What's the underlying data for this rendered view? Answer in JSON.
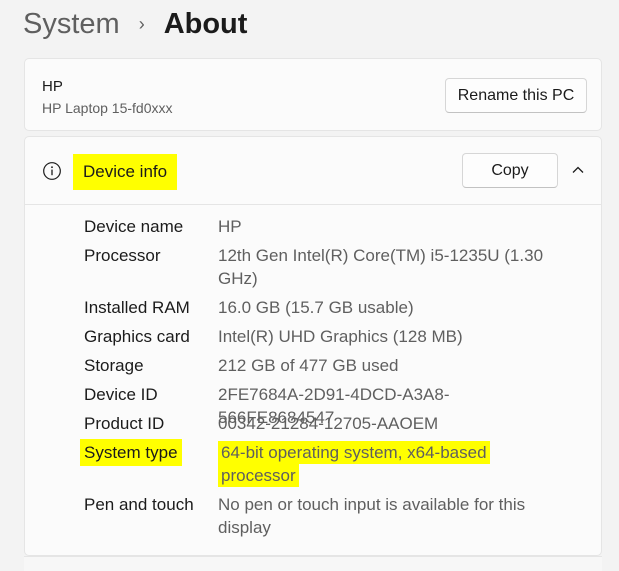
{
  "breadcrumb": {
    "parent": "System",
    "separator": "›",
    "current": "About"
  },
  "pc": {
    "name": "HP",
    "model": "HP Laptop 15-fd0xxx",
    "rename_label": "Rename this PC"
  },
  "device_info": {
    "title": "Device info",
    "copy_label": "Copy",
    "icon": "info-icon",
    "collapse_icon": "chevron-up-icon",
    "highlight_color": "#ffff00",
    "specs": [
      {
        "label": "Device name",
        "value": "HP"
      },
      {
        "label": "Processor",
        "value": "12th Gen Intel(R) Core(TM) i5-1235U (1.30 GHz)"
      },
      {
        "label": "Installed RAM",
        "value": "16.0 GB (15.7 GB usable)"
      },
      {
        "label": "Graphics card",
        "value": "Intel(R) UHD Graphics (128 MB)"
      },
      {
        "label": "Storage",
        "value": "212 GB of 477 GB used"
      },
      {
        "label": "Device ID",
        "value": "2FE7684A-2D91-4DCD-A3A8-566FE8684547"
      },
      {
        "label": "Product ID",
        "value": "00342-21284-12705-AAOEM"
      },
      {
        "label": "System type",
        "value": "64-bit operating system, x64-based processor"
      },
      {
        "label": "Pen and touch",
        "value": "No pen or touch input is available for this display"
      }
    ]
  }
}
